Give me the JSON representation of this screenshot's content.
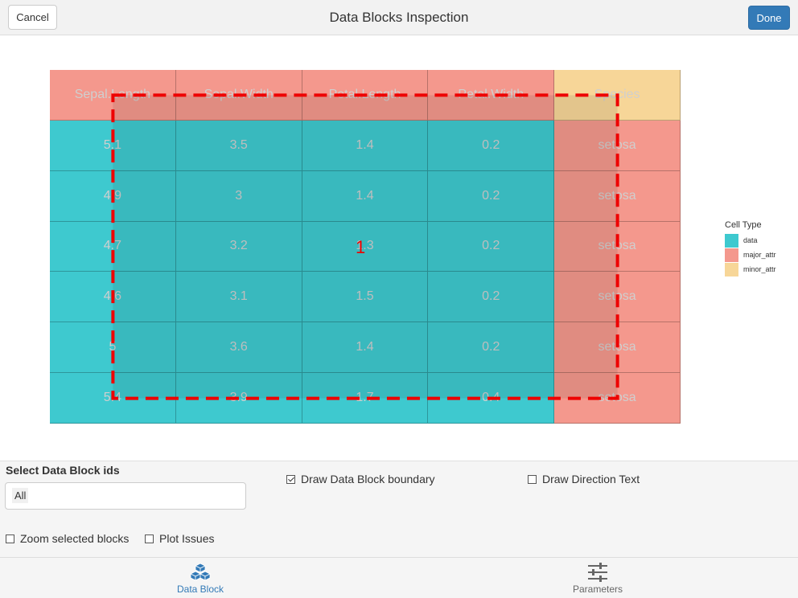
{
  "header": {
    "cancel_label": "Cancel",
    "title": "Data Blocks Inspection",
    "done_label": "Done"
  },
  "grid": {
    "colors": {
      "data": "#3ec9cf",
      "major_attr": "#f4988d",
      "minor_attr": "#f7d698",
      "boundary": "#ee0000"
    },
    "text_color": "#cfcfcf",
    "rows": [
      [
        {
          "t": "major_attr",
          "v": "Sepal.Length"
        },
        {
          "t": "major_attr",
          "v": "Sepal.Width"
        },
        {
          "t": "major_attr",
          "v": "Petal.Length"
        },
        {
          "t": "major_attr",
          "v": "Petal.Width"
        },
        {
          "t": "minor_attr",
          "v": "Species"
        }
      ],
      [
        {
          "t": "data",
          "v": "5.1"
        },
        {
          "t": "data",
          "v": "3.5"
        },
        {
          "t": "data",
          "v": "1.4"
        },
        {
          "t": "data",
          "v": "0.2"
        },
        {
          "t": "major_attr",
          "v": "setosa"
        }
      ],
      [
        {
          "t": "data",
          "v": "4.9"
        },
        {
          "t": "data",
          "v": "3"
        },
        {
          "t": "data",
          "v": "1.4"
        },
        {
          "t": "data",
          "v": "0.2"
        },
        {
          "t": "major_attr",
          "v": "setosa"
        }
      ],
      [
        {
          "t": "data",
          "v": "4.7"
        },
        {
          "t": "data",
          "v": "3.2"
        },
        {
          "t": "data",
          "v": "1.3"
        },
        {
          "t": "data",
          "v": "0.2"
        },
        {
          "t": "major_attr",
          "v": "setosa"
        }
      ],
      [
        {
          "t": "data",
          "v": "4.6"
        },
        {
          "t": "data",
          "v": "3.1"
        },
        {
          "t": "data",
          "v": "1.5"
        },
        {
          "t": "data",
          "v": "0.2"
        },
        {
          "t": "major_attr",
          "v": "setosa"
        }
      ],
      [
        {
          "t": "data",
          "v": "5"
        },
        {
          "t": "data",
          "v": "3.6"
        },
        {
          "t": "data",
          "v": "1.4"
        },
        {
          "t": "data",
          "v": "0.2"
        },
        {
          "t": "major_attr",
          "v": "setosa"
        }
      ],
      [
        {
          "t": "data",
          "v": "5.4"
        },
        {
          "t": "data",
          "v": "3.9"
        },
        {
          "t": "data",
          "v": "1.7"
        },
        {
          "t": "data",
          "v": "0.4"
        },
        {
          "t": "major_attr",
          "v": "setosa"
        }
      ]
    ],
    "block_label": "1"
  },
  "legend": {
    "title": "Cell Type",
    "items": [
      {
        "label": "data",
        "color": "#3ec9cf"
      },
      {
        "label": "major_attr",
        "color": "#f4988d"
      },
      {
        "label": "minor_attr",
        "color": "#f7d698"
      }
    ]
  },
  "controls": {
    "select_label": "Select Data Block ids",
    "select_value": "All",
    "draw_boundary_label": "Draw Data Block boundary",
    "draw_boundary_checked": true,
    "draw_direction_label": "Draw Direction Text",
    "draw_direction_checked": false,
    "zoom_label": "Zoom selected blocks",
    "zoom_checked": false,
    "plot_issues_label": "Plot Issues",
    "plot_issues_checked": false
  },
  "tabs": {
    "data_block_label": "Data Block",
    "parameters_label": "Parameters",
    "active_color": "#337ab7",
    "inactive_color": "#666666"
  }
}
